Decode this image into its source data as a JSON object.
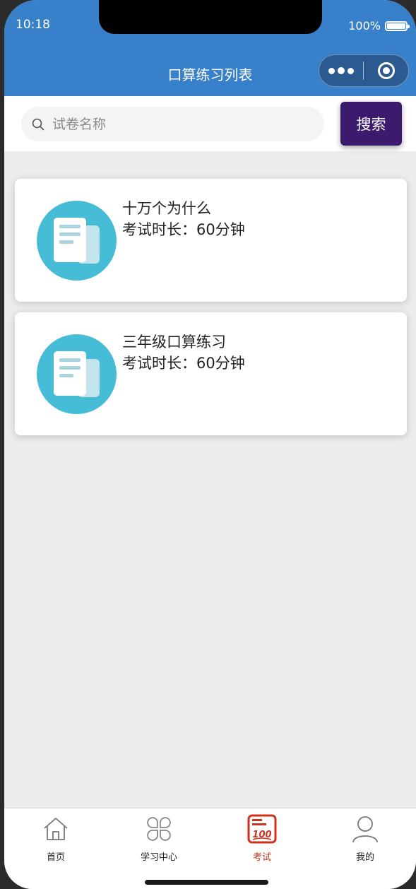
{
  "status_bar": {
    "time": "10:18",
    "battery": "100%"
  },
  "nav": {
    "title": "口算练习列表"
  },
  "search": {
    "placeholder": "试卷名称",
    "button_label": "搜索"
  },
  "exams": [
    {
      "title": "十万个为什么",
      "duration": "考试时长：60分钟"
    },
    {
      "title": "三年级口算练习",
      "duration": "考试时长：60分钟"
    }
  ],
  "tabbar": {
    "items": [
      {
        "label": "首页",
        "icon": "home-icon",
        "active": false
      },
      {
        "label": "学习中心",
        "icon": "clover-icon",
        "active": false
      },
      {
        "label": "考试",
        "icon": "exam-100-icon",
        "active": true
      },
      {
        "label": "我的",
        "icon": "user-icon",
        "active": false
      }
    ]
  },
  "colors": {
    "nav_bg": "#3880c9",
    "search_button": "#3c1a6e",
    "active_tab": "#c8321e",
    "avatar_bg": "#46bcd6"
  }
}
